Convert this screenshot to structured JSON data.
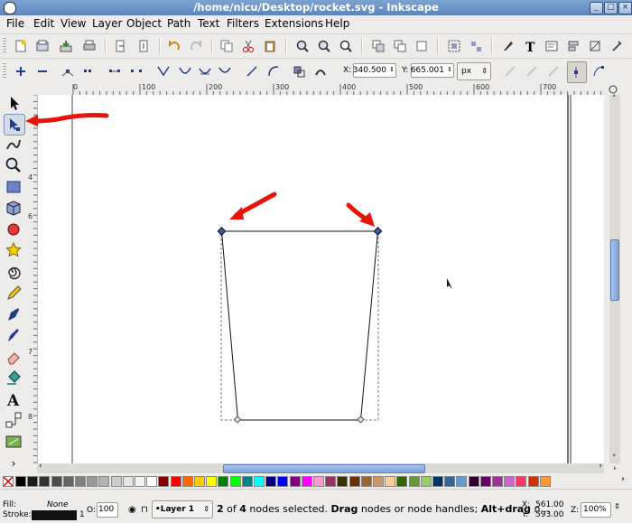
{
  "window": {
    "title": "/home/nicu/Desktop/rocket.svg - Inkscape",
    "controls": [
      "minimize-icon",
      "maximize-icon",
      "close-icon"
    ]
  },
  "menu": [
    "File",
    "Edit",
    "View",
    "Layer",
    "Object",
    "Path",
    "Text",
    "Filters",
    "Extensions",
    "Help"
  ],
  "tool_controls": {
    "x_label": "X:",
    "x_value": "340.500",
    "y_label": "Y:",
    "y_value": "665.001",
    "unit": "px"
  },
  "ruler": {
    "h_labels": [
      "0",
      "100",
      "200",
      "300",
      "400",
      "500",
      "600",
      "700"
    ],
    "v_labels": [
      "4",
      "6",
      "7",
      "8"
    ]
  },
  "toolbox": [
    "selector-tool-icon",
    "node-tool-icon",
    "tweak-tool-icon",
    "zoom-tool-icon",
    "rectangle-tool-icon",
    "3d-box-tool-icon",
    "ellipse-tool-icon",
    "star-tool-icon",
    "spiral-tool-icon",
    "pencil-tool-icon",
    "pen-tool-icon",
    "calligraphy-tool-icon",
    "eraser-tool-icon",
    "paint-bucket-tool-icon",
    "text-tool-icon",
    "connector-tool-icon",
    "gradient-tool-icon",
    "expand-icon"
  ],
  "palette_colors": [
    "#000000",
    "#1a1a1a",
    "#333333",
    "#4d4d4d",
    "#666666",
    "#808080",
    "#999999",
    "#b3b3b3",
    "#cccccc",
    "#e6e6e6",
    "#f2f2f2",
    "#ffffff",
    "#800000",
    "#ff0000",
    "#ff6600",
    "#ffcc00",
    "#ffff00",
    "#008000",
    "#00ff00",
    "#008080",
    "#00ffff",
    "#000080",
    "#0000ff",
    "#800080",
    "#ff00ff",
    "#ff99cc",
    "#993366",
    "#333300",
    "#663300",
    "#996633",
    "#cc9966",
    "#ffcc99",
    "#336600",
    "#669933",
    "#99cc66",
    "#003366",
    "#336699",
    "#6699cc",
    "#330033",
    "#660066",
    "#993399",
    "#cc66cc",
    "#ff3366",
    "#cc3300",
    "#ff9933"
  ],
  "status": {
    "fill_label": "Fill:",
    "fill_value": "None",
    "stroke_label": "Stroke:",
    "stroke_width": "1",
    "opacity_label": "O:",
    "opacity_value": "100",
    "layer": "•Layer 1",
    "message_prefix": "2",
    "message_of": " of ",
    "message_count": "4",
    "message_mid": " nodes selected. ",
    "message_drag": "Drag",
    "message_mid2": " nodes or node handles; ",
    "message_alt": "Alt+drag",
    "message_tail": " n...",
    "x_label": "X:",
    "x_coord": "561.00",
    "y_label": "Y:",
    "y_coord": "593.00",
    "zoom_label": "Z:",
    "zoom_value": "100%"
  },
  "annotation_color": "#e8140a"
}
